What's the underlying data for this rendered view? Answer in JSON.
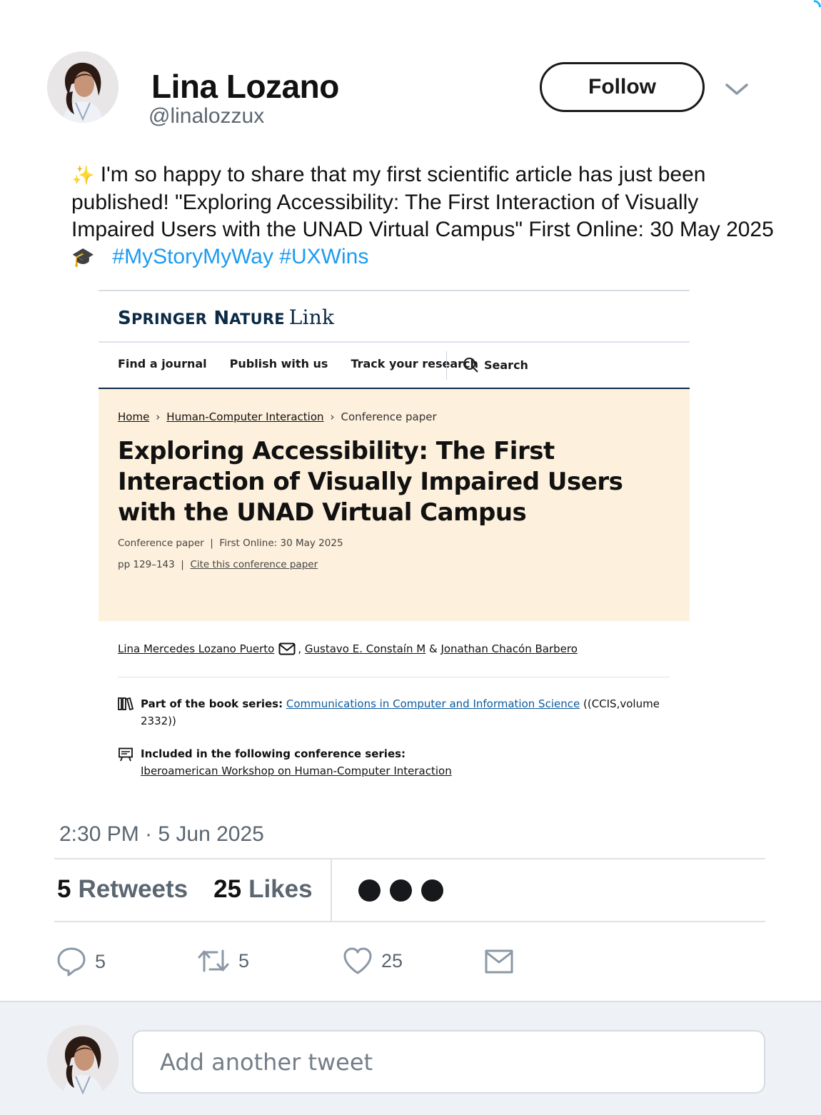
{
  "user": {
    "name": "Lina Lozano",
    "handle": "@linalozzux",
    "follow_label": "Follow"
  },
  "tweet": {
    "sparkle_emoji": "✨",
    "text": " I'm so happy to share that my first scientific article has just been published! \"Exploring Accessibility: The First Interaction of Visually Impaired Users with the UNAD Virtual Campus\" First Online: 30 May 2025 ",
    "grad_emoji": "🎓",
    "hashtags": "#MyStoryMyWay #UXWins"
  },
  "embed": {
    "logo_springer": "Springer",
    "logo_nature": "Nature",
    "logo_link": "Link",
    "nav": {
      "find_journal": "Find a journal",
      "publish": "Publish with us",
      "track": "Track your research",
      "search": "Search"
    },
    "breadcrumb": {
      "home": "Home",
      "category": "Human-Computer Interaction",
      "current": "Conference paper"
    },
    "title": "Exploring Accessibility: The First Interaction of Visually Impaired Users with the UNAD Virtual Campus",
    "meta_type": "Conference paper",
    "meta_online": "First Online: 30 May 2025",
    "pages": "pp 129–143",
    "cite": "Cite this conference paper",
    "authors": {
      "author1": "Lina Mercedes Lozano Puerto",
      "author2": "Gustavo E. Constaín M",
      "and": "&",
      "author3": "Jonathan Chacón Barbero"
    },
    "book_series_label": "Part of the book series:",
    "book_series_name": "Communications in Computer and Information Science",
    "book_series_suffix": "((CCIS,volume 2332))",
    "conf_series_label": "Included in the following conference series:",
    "conf_series_name": "Iberoamerican Workshop on Human-Computer Interaction"
  },
  "timestamp": "2:30 PM · 5 Jun 2025",
  "stats": {
    "retweets_count": "5",
    "retweets_label": "Retweets",
    "likes_count": "25",
    "likes_label": "Likes"
  },
  "actions": {
    "reply_count": "5",
    "retweet_count": "5",
    "like_count": "25"
  },
  "reply_placeholder": "Add another tweet",
  "colors": {
    "hashtag": "#1d9bf0",
    "muted": "#5b6670",
    "hero_bg": "#fdf0dc",
    "springer_navy": "#0b2a45"
  }
}
